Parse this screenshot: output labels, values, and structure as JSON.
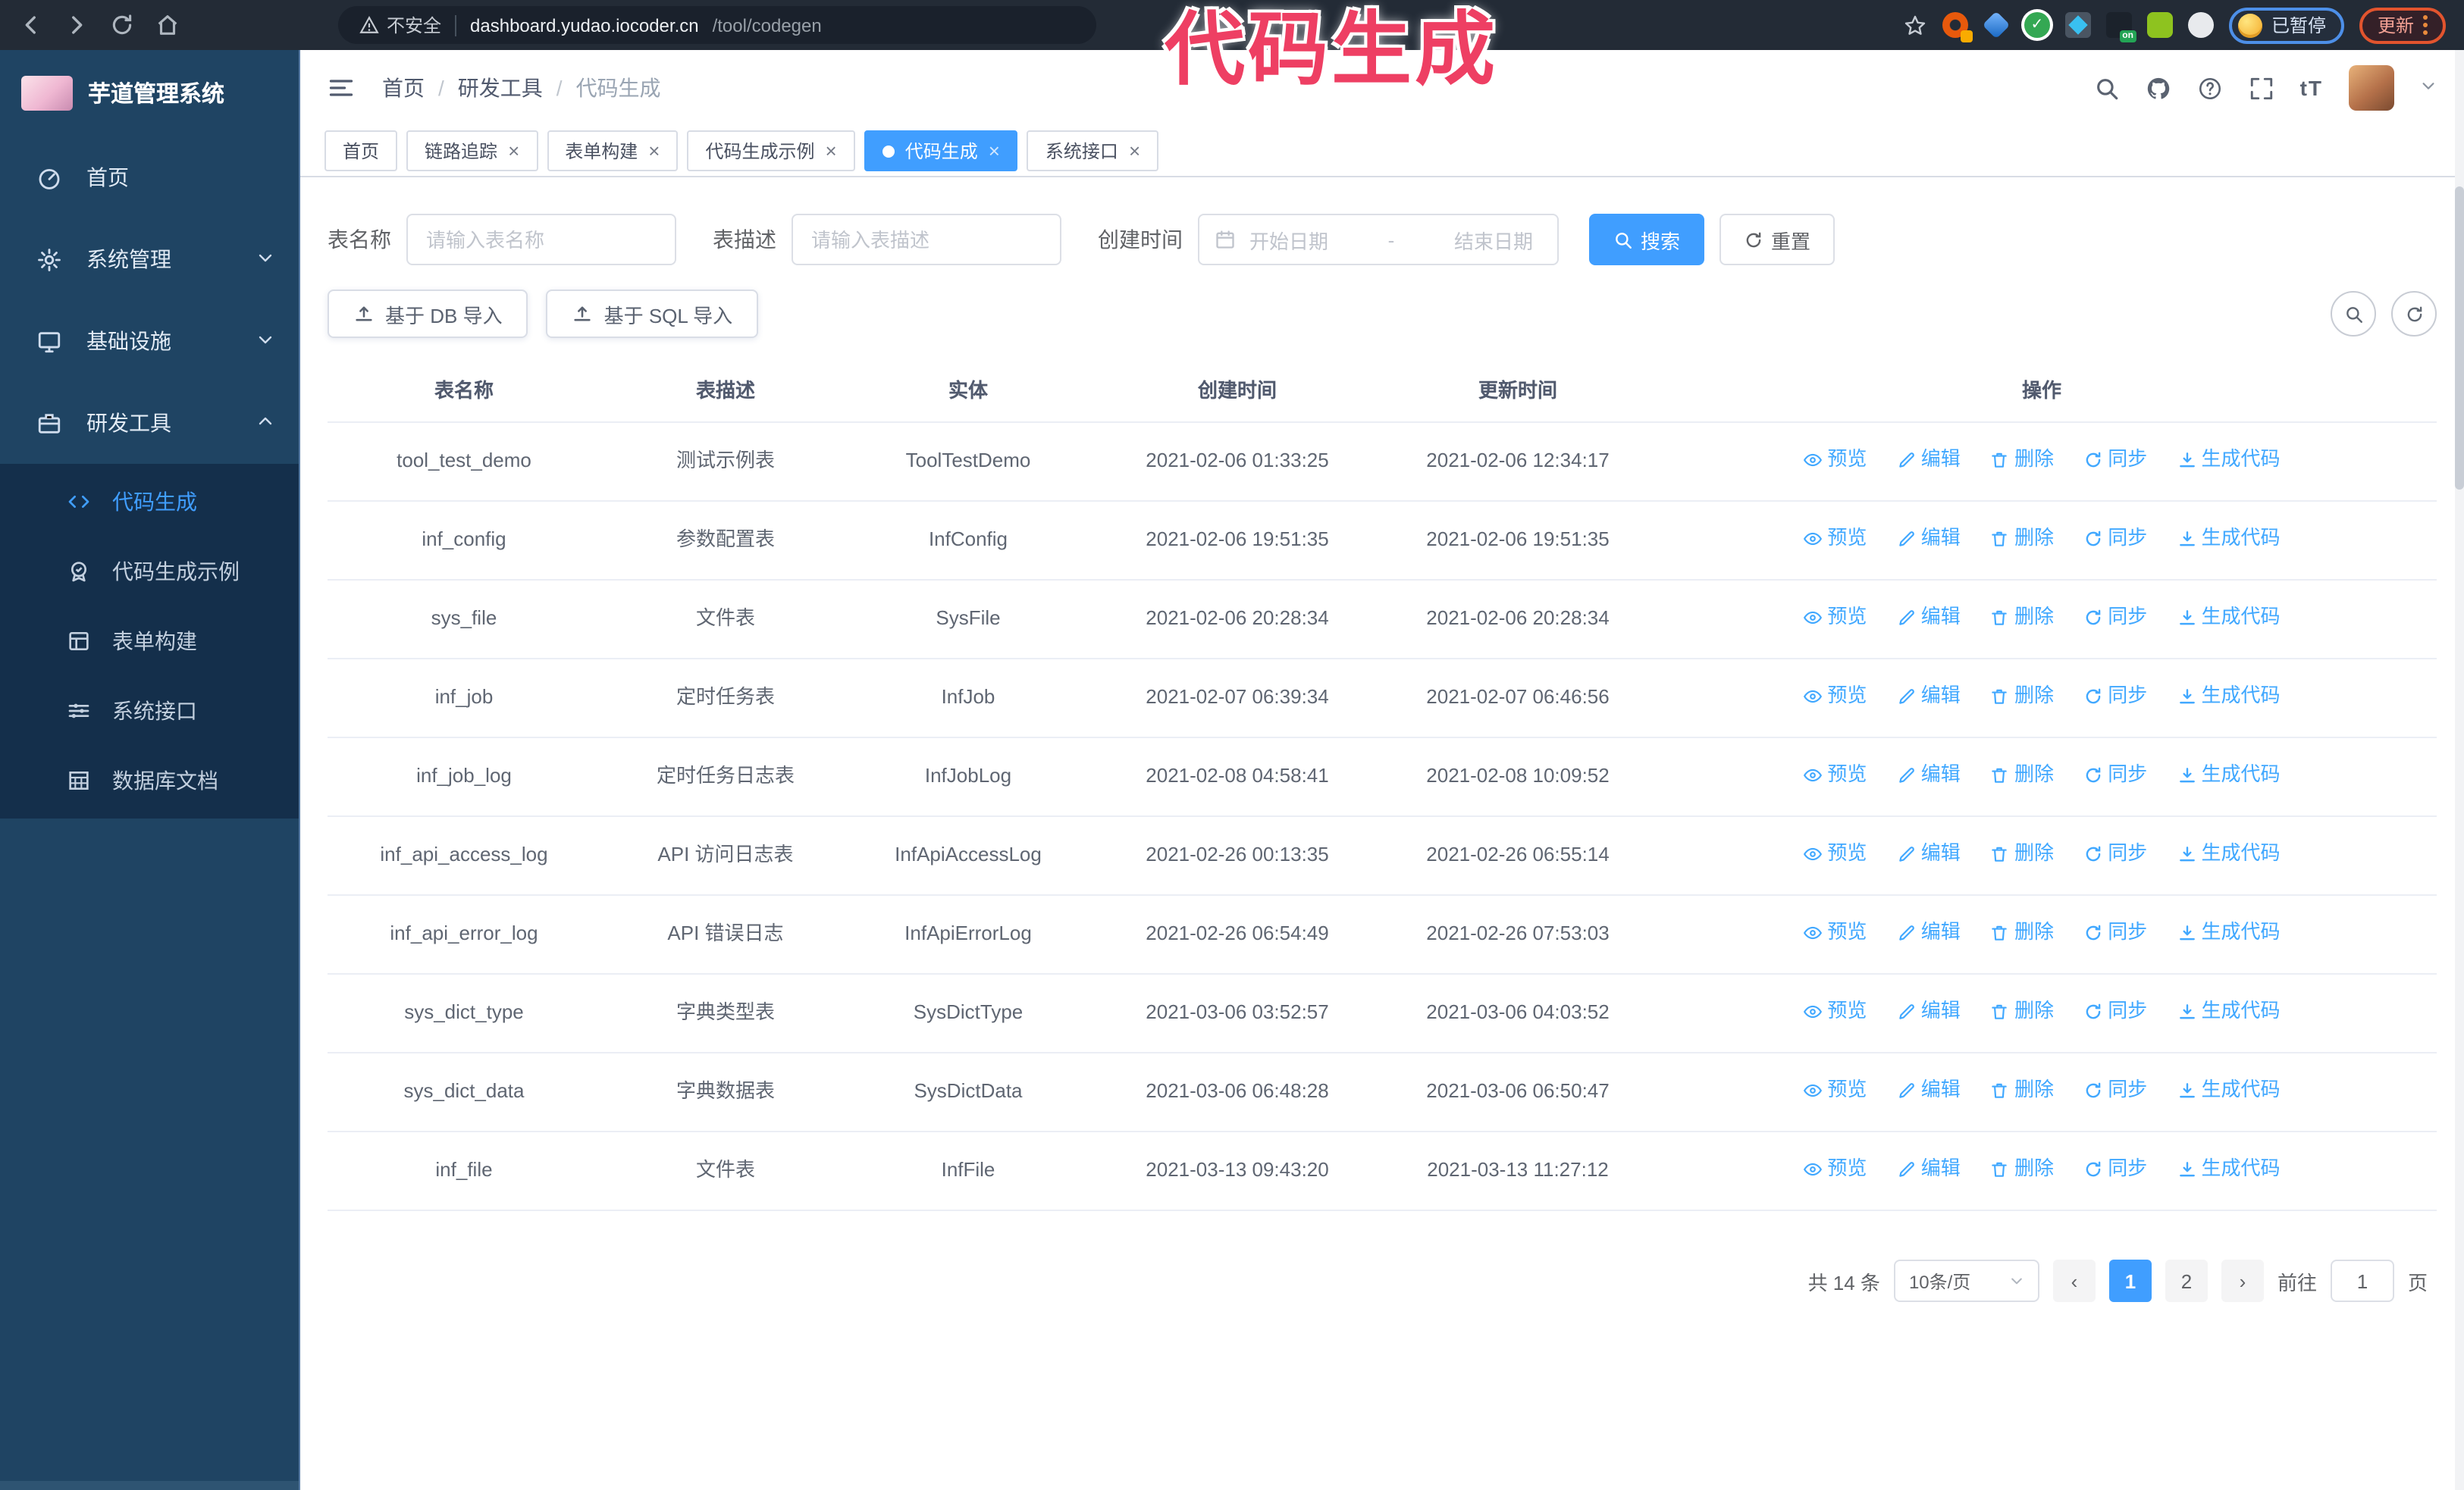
{
  "colors": {
    "accent": "#409eff",
    "link": "#41a8ff",
    "sidebar_bg": "#1f4463",
    "submenu_bg": "#142f4b",
    "browser_bar": "#232b36",
    "annotation": "#ee3f63"
  },
  "browser": {
    "security_label": "不安全",
    "url_host": "dashboard.yudao.iocoder.cn",
    "url_path": "/tool/codegen",
    "extension_badge": "on",
    "paused_chip": "已暂停",
    "update_chip": "更新"
  },
  "annotation": {
    "text": "代码生成"
  },
  "sidebar": {
    "title": "芋道管理系统",
    "items": [
      {
        "label": "首页"
      },
      {
        "label": "系统管理"
      },
      {
        "label": "基础设施"
      },
      {
        "label": "研发工具"
      }
    ],
    "submenu": [
      {
        "label": "代码生成"
      },
      {
        "label": "代码生成示例"
      },
      {
        "label": "表单构建"
      },
      {
        "label": "系统接口"
      },
      {
        "label": "数据库文档"
      }
    ]
  },
  "header": {
    "breadcrumb": [
      "首页",
      "研发工具",
      "代码生成"
    ],
    "separator": "/"
  },
  "glyphs": {
    "close": "×",
    "text_size": "tT"
  },
  "tabs": [
    {
      "label": "首页"
    },
    {
      "label": "链路追踪"
    },
    {
      "label": "表单构建"
    },
    {
      "label": "代码生成示例"
    },
    {
      "label": "代码生成"
    },
    {
      "label": "系统接口"
    }
  ],
  "search_form": {
    "name_label": "表名称",
    "name_placeholder": "请输入表名称",
    "desc_label": "表描述",
    "desc_placeholder": "请输入表描述",
    "time_label": "创建时间",
    "start_placeholder": "开始日期",
    "range_separator": "-",
    "end_placeholder": "结束日期",
    "search_button": "搜索",
    "reset_button": "重置"
  },
  "toolbar": {
    "import_db_button": "基于 DB 导入",
    "import_sql_button": "基于 SQL 导入"
  },
  "table": {
    "headers": [
      "表名称",
      "表描述",
      "实体",
      "创建时间",
      "更新时间",
      "操作"
    ],
    "rows": [
      {
        "name": "tool_test_demo",
        "desc": "测试示例表",
        "entity": "ToolTestDemo",
        "created": "2021-02-06 01:33:25",
        "updated": "2021-02-06 12:34:17"
      },
      {
        "name": "inf_config",
        "desc": "参数配置表",
        "entity": "InfConfig",
        "created": "2021-02-06 19:51:35",
        "updated": "2021-02-06 19:51:35"
      },
      {
        "name": "sys_file",
        "desc": "文件表",
        "entity": "SysFile",
        "created": "2021-02-06 20:28:34",
        "updated": "2021-02-06 20:28:34"
      },
      {
        "name": "inf_job",
        "desc": "定时任务表",
        "entity": "InfJob",
        "created": "2021-02-07 06:39:34",
        "updated": "2021-02-07 06:46:56"
      },
      {
        "name": "inf_job_log",
        "desc": "定时任务日志表",
        "entity": "InfJobLog",
        "created": "2021-02-08 04:58:41",
        "updated": "2021-02-08 10:09:52"
      },
      {
        "name": "inf_api_access_log",
        "desc": "API 访问日志表",
        "entity": "InfApiAccessLog",
        "created": "2021-02-26 00:13:35",
        "updated": "2021-02-26 06:55:14"
      },
      {
        "name": "inf_api_error_log",
        "desc": "API 错误日志",
        "entity": "InfApiErrorLog",
        "created": "2021-02-26 06:54:49",
        "updated": "2021-02-26 07:53:03"
      },
      {
        "name": "sys_dict_type",
        "desc": "字典类型表",
        "entity": "SysDictType",
        "created": "2021-03-06 03:52:57",
        "updated": "2021-03-06 04:03:52"
      },
      {
        "name": "sys_dict_data",
        "desc": "字典数据表",
        "entity": "SysDictData",
        "created": "2021-03-06 06:48:28",
        "updated": "2021-03-06 06:50:47"
      },
      {
        "name": "inf_file",
        "desc": "文件表",
        "entity": "InfFile",
        "created": "2021-03-13 09:43:20",
        "updated": "2021-03-13 11:27:12"
      }
    ]
  },
  "row_actions": [
    "预览",
    "编辑",
    "删除",
    "同步",
    "生成代码"
  ],
  "pagination": {
    "total": "共 14 条",
    "page_size": "10条/页",
    "prev": "‹",
    "pages": [
      "1",
      "2"
    ],
    "next": "›",
    "goto_label": "前往",
    "goto_value": "1",
    "goto_suffix": "页"
  }
}
